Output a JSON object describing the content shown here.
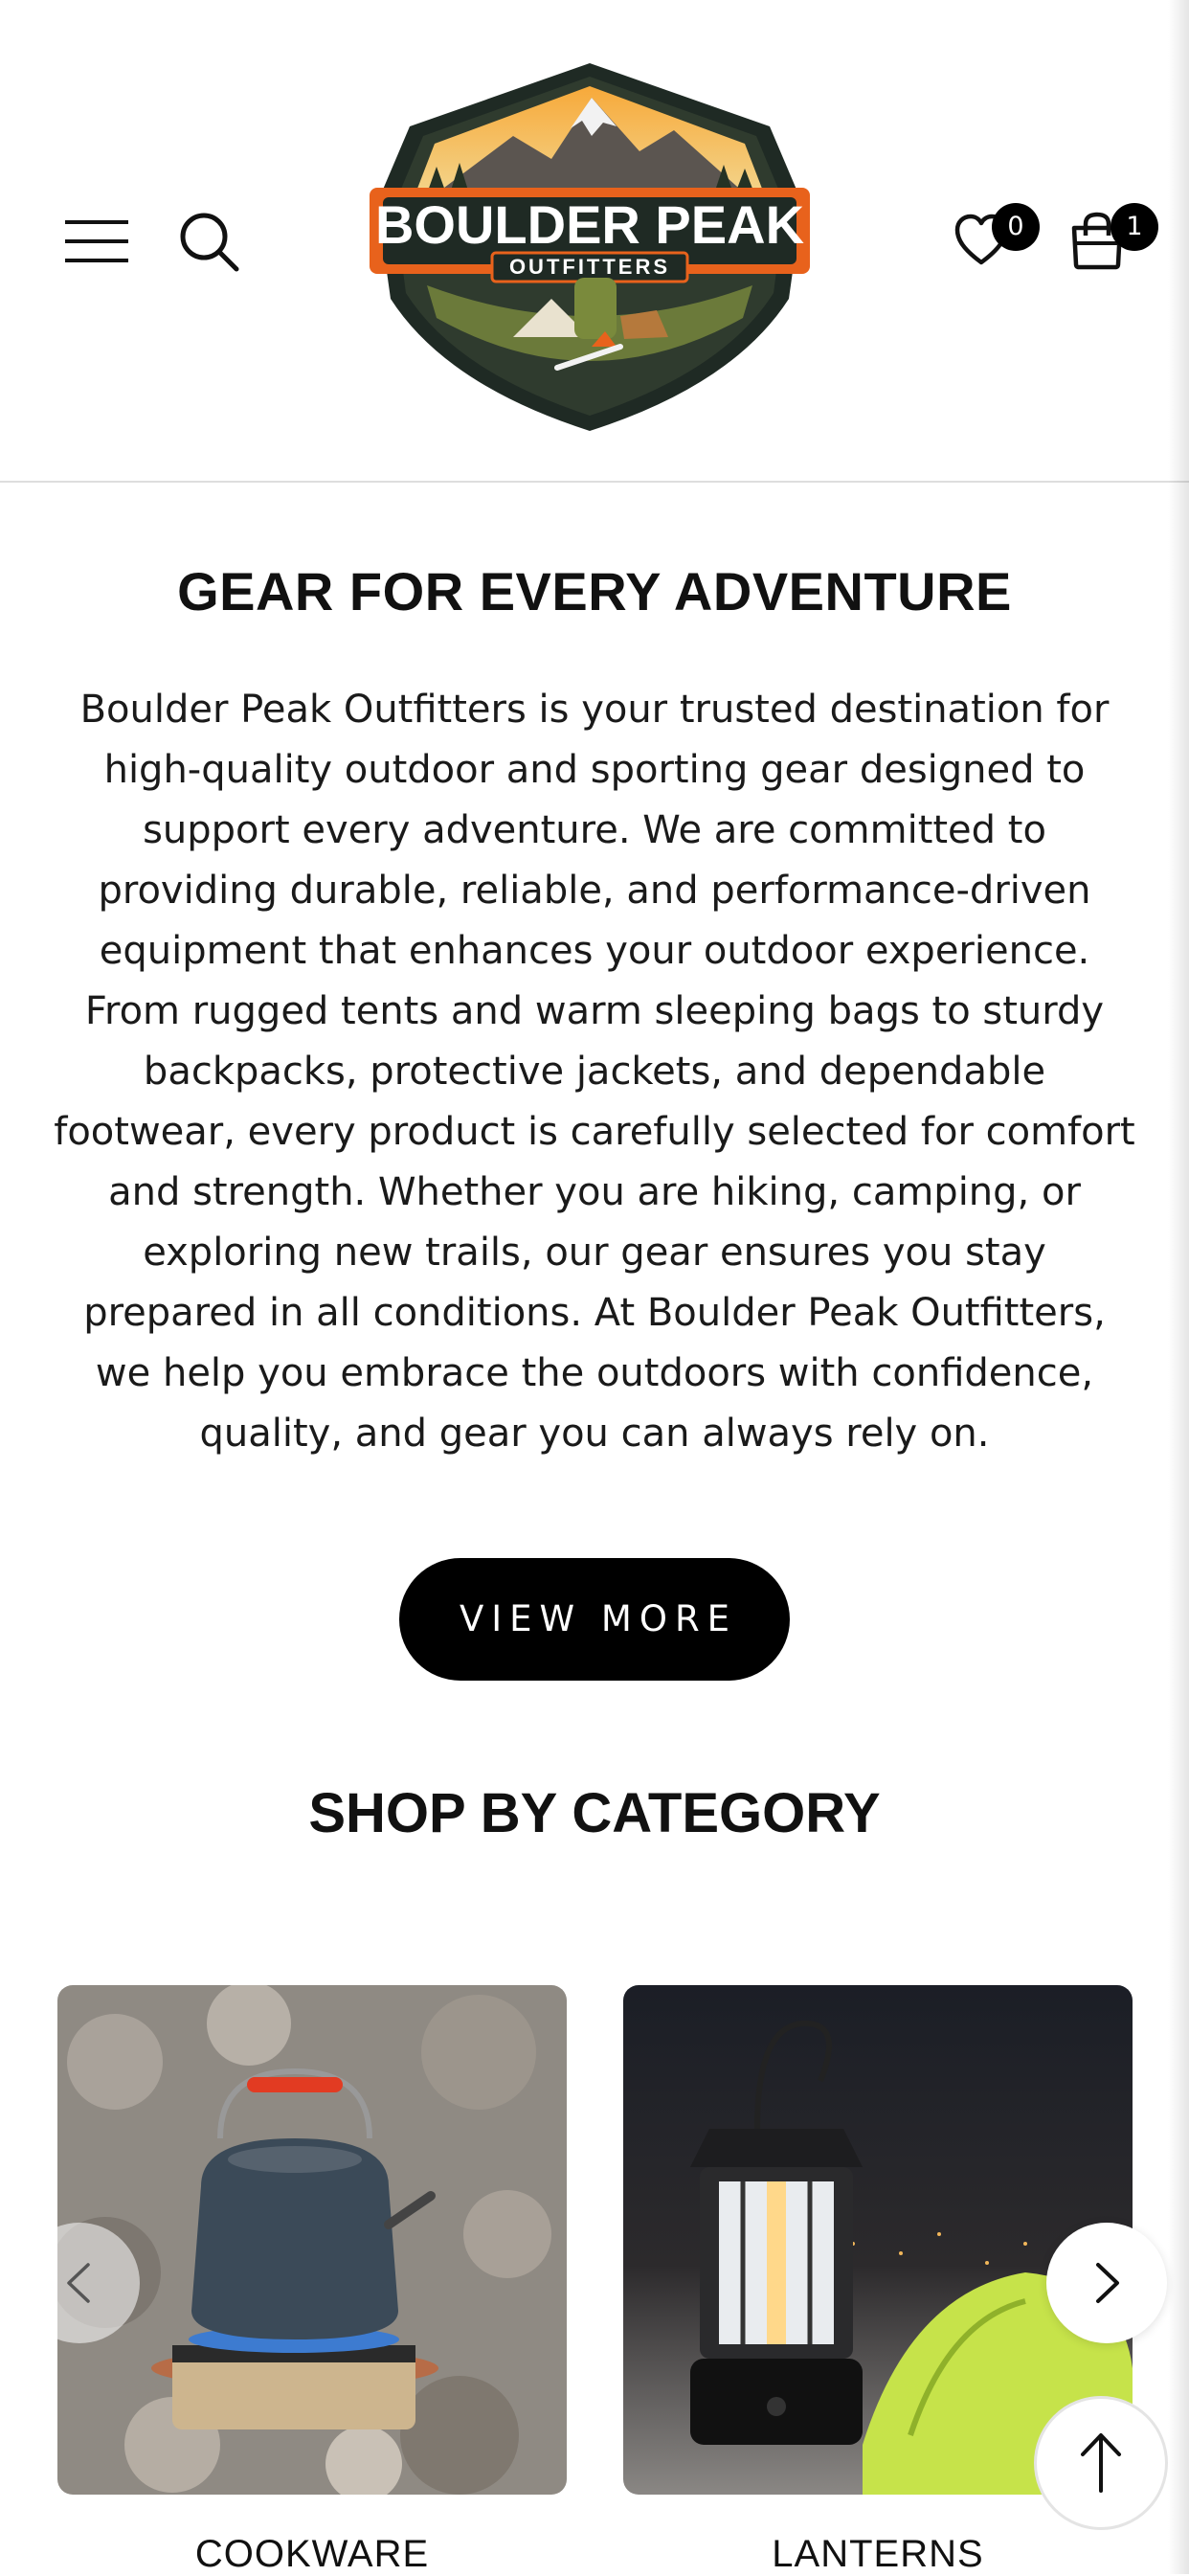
{
  "header": {
    "wishlist_count": "0",
    "cart_count": "1",
    "logo": {
      "brand": "BOULDER PEAK",
      "sub": "OUTFITTERS"
    }
  },
  "intro": {
    "title": "GEAR FOR EVERY ADVENTURE",
    "text": "Boulder Peak Outfitters is your trusted destination for high-quality outdoor and sporting gear designed to support every adventure. We are committed to providing durable, reliable, and performance-driven equipment that enhances your outdoor experience. From rugged tents and warm sleeping bags to sturdy backpacks, protective jackets, and dependable footwear, every product is carefully selected for comfort and strength. Whether you are hiking, camping, or exploring new trails, our gear ensures you stay prepared in all conditions. At Boulder Peak Outfitters, we help you embrace the outdoors with confidence, quality, and gear you can always rely on.",
    "button_label": "VIEW MORE"
  },
  "categories": {
    "title": "SHOP BY CATEGORY",
    "items": [
      {
        "label": "COOKWARE"
      },
      {
        "label": "LANTERNS"
      }
    ]
  },
  "icons": {
    "menu": "hamburger-menu-icon",
    "search": "search-icon",
    "wishlist": "heart-icon",
    "cart": "shopping-bag-icon",
    "prev": "chevron-left-icon",
    "next": "chevron-right-icon",
    "top": "arrow-up-icon"
  },
  "colors": {
    "accent": "#000000",
    "logo_orange": "#e8621c",
    "logo_dark": "#1f2a24"
  }
}
